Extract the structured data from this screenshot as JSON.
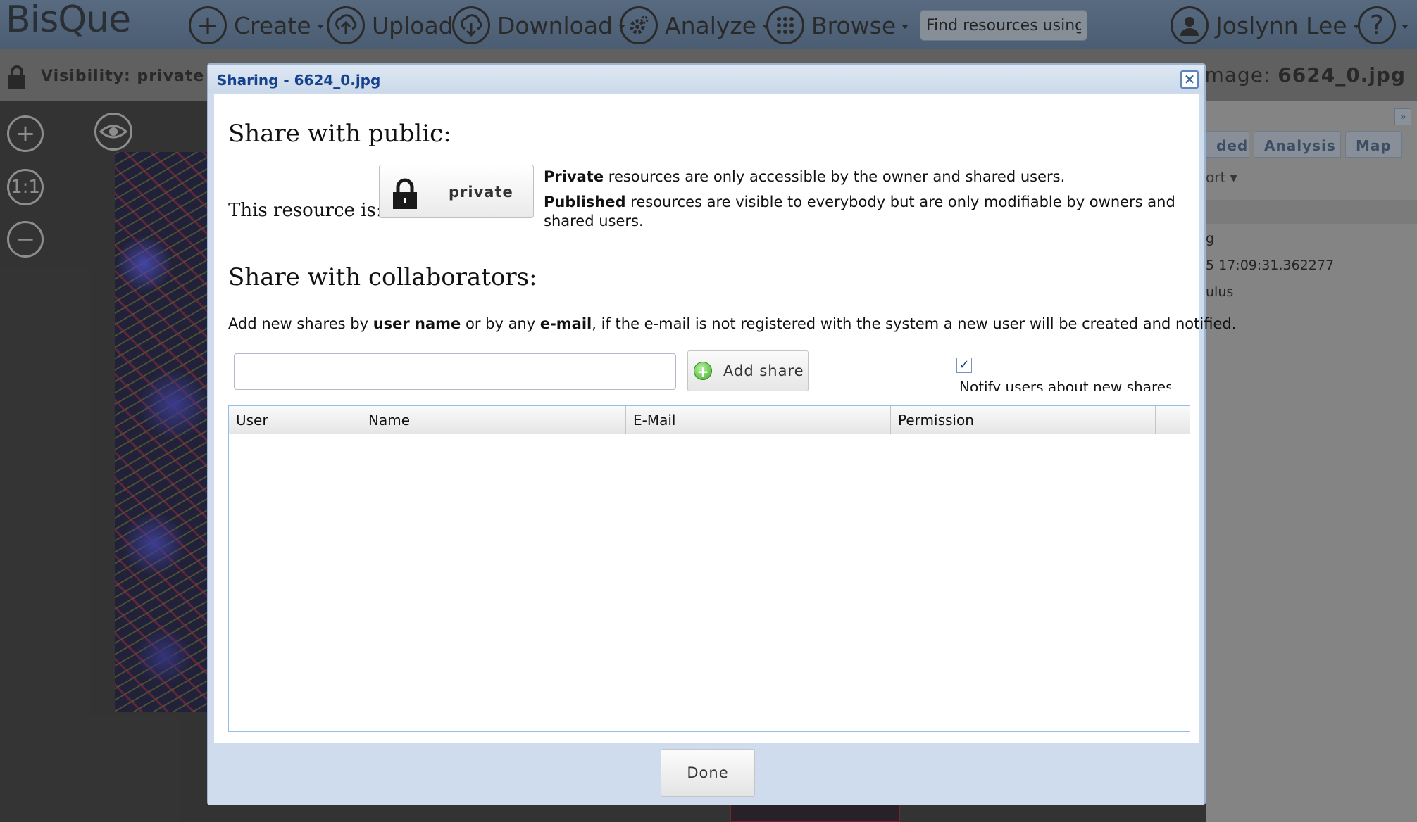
{
  "navbar": {
    "logo": "BisQue",
    "create_label": "Create",
    "upload_label": "Upload",
    "download_label": "Download",
    "analyze_label": "Analyze",
    "browse_label": "Browse",
    "search_value": "Find resources using ta",
    "user_name": "Joslynn Lee"
  },
  "subbar": {
    "visibility_label": "Visibility: private",
    "image_label_prefix": "image: ",
    "image_name": "6624_0.jpg"
  },
  "viewer": {
    "zoom_reset_label": "1:1"
  },
  "right_panel": {
    "tabs": [
      "ded",
      "Analysis",
      "Map"
    ],
    "export_label": "ort",
    "rows": [
      "g",
      "5 17:09:31.362277",
      "ulus"
    ]
  },
  "dialog": {
    "title": "Sharing - 6624_0.jpg",
    "close_label": "×",
    "public_heading": "Share with public:",
    "resource_is_label": "This resource is:",
    "toggle_label": "private",
    "private_desc_bold": "Private",
    "private_desc_rest": " resources are only accessible by the owner and shared users.",
    "published_desc_bold": "Published",
    "published_desc_rest": " resources are visible to everybody but are only modifiable by owners and shared users.",
    "collab_heading": "Share with collaborators:",
    "instructions_1": "Add new shares by ",
    "instructions_user_name": "user name",
    "instructions_2": " or by any ",
    "instructions_email": "e-mail",
    "instructions_3": ", if the e-mail is not registered with the system a new user will be created and notified.",
    "share_input_value": "",
    "add_share_label": "Add share",
    "notify_checked": true,
    "notify_label": "Notify users about new shares",
    "grid_columns": [
      "User",
      "Name",
      "E-Mail",
      "Permission",
      ""
    ],
    "grid_rows": [],
    "done_label": "Done"
  },
  "colors": {
    "navbar": "#5f82aa",
    "dialog_frame": "#cfdced",
    "dialog_title": "#15428b",
    "grid_border": "#99bce8"
  }
}
